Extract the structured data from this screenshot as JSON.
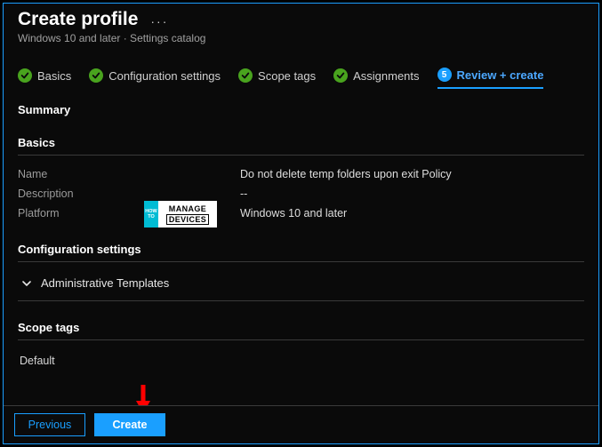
{
  "header": {
    "title": "Create profile",
    "more": "···",
    "subtitle": "Windows 10 and later · Settings catalog"
  },
  "steps": {
    "s1": "Basics",
    "s2": "Configuration settings",
    "s3": "Scope tags",
    "s4": "Assignments",
    "s5_num": "5",
    "s5": "Review + create"
  },
  "summary_label": "Summary",
  "basics": {
    "heading": "Basics",
    "name_label": "Name",
    "name_value": "Do not delete temp folders upon exit Policy",
    "desc_label": "Description",
    "desc_value": "--",
    "platform_label": "Platform",
    "platform_value": "Windows 10 and later"
  },
  "config": {
    "heading": "Configuration settings",
    "row1": "Administrative Templates"
  },
  "scope": {
    "heading": "Scope tags",
    "item": "Default"
  },
  "footer": {
    "prev": "Previous",
    "create": "Create"
  },
  "logo": {
    "l1": "MANAGE",
    "l2": "DEVICES",
    "side1": "HOW",
    "side2": "TO"
  }
}
